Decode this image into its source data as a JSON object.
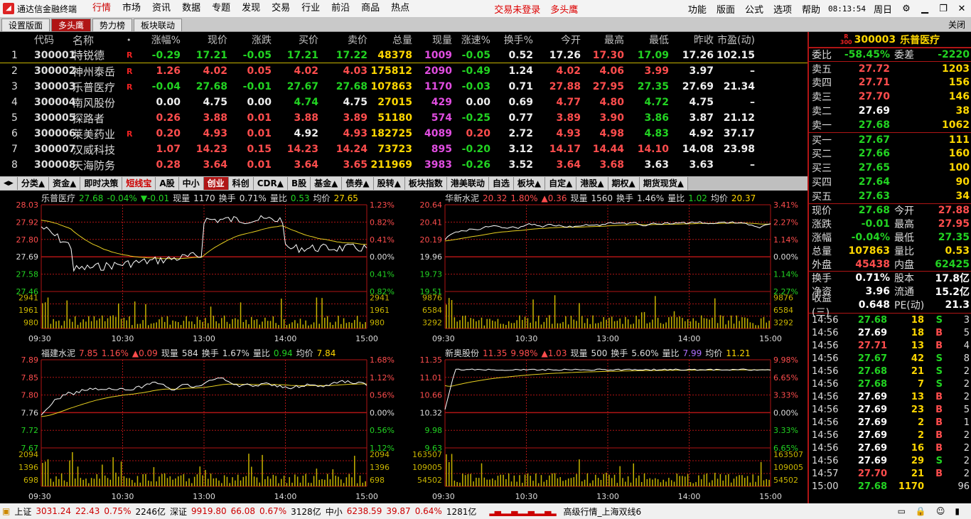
{
  "app": {
    "title": "通达信金融终端",
    "icon": "app-logo-icon"
  },
  "menu": [
    "行情",
    "市场",
    "资讯",
    "数据",
    "专题",
    "发现",
    "交易",
    "行业",
    "前沿",
    "商品",
    "热点"
  ],
  "redlinks": [
    "交易未登录",
    "多头鹰"
  ],
  "rmenu": [
    "功能",
    "版面",
    "公式",
    "选项",
    "帮助"
  ],
  "clock": "08:13:54",
  "weekday": "周日",
  "tabs": [
    "设置版面",
    "多头鹰",
    "势力榜",
    "板块联动"
  ],
  "close_label": "关闭",
  "grid": {
    "headers": [
      "",
      "代码",
      "名称",
      "•",
      "涨幅%",
      "现价",
      "涨跌",
      "买价",
      "卖价",
      "总量",
      "现量",
      "涨速%",
      "换手%",
      "今开",
      "最高",
      "最低",
      "昨收",
      "市盈(动)"
    ],
    "rows": [
      {
        "n": "1",
        "code": "300001",
        "name": "特锐德",
        "flag": "R",
        "chg": "-0.29",
        "price": "17.21",
        "diff": "-0.05",
        "bid": "17.21",
        "ask": "17.22",
        "vol": "48378",
        "cur": "1009",
        "spd": "-0.05",
        "turn": "0.52",
        "open": "17.26",
        "high": "17.30",
        "low": "17.09",
        "prev": "17.26",
        "pe": "102.15"
      },
      {
        "n": "2",
        "code": "300002",
        "name": "神州泰岳",
        "flag": "R",
        "chg": "1.26",
        "price": "4.02",
        "diff": "0.05",
        "bid": "4.02",
        "ask": "4.03",
        "vol": "175812",
        "cur": "2090",
        "spd": "-0.49",
        "turn": "1.24",
        "open": "4.02",
        "high": "4.06",
        "low": "3.99",
        "prev": "3.97",
        "pe": "–"
      },
      {
        "n": "3",
        "code": "300003",
        "name": "乐普医疗",
        "flag": "R",
        "chg": "-0.04",
        "price": "27.68",
        "diff": "-0.01",
        "bid": "27.67",
        "ask": "27.68",
        "vol": "107863",
        "cur": "1170",
        "spd": "-0.03",
        "turn": "0.71",
        "open": "27.88",
        "high": "27.95",
        "low": "27.35",
        "prev": "27.69",
        "pe": "21.34"
      },
      {
        "n": "4",
        "code": "300004",
        "name": "南风股份",
        "flag": "",
        "chg": "0.00",
        "price": "4.75",
        "diff": "0.00",
        "bid": "4.74",
        "ask": "4.75",
        "vol": "27015",
        "cur": "429",
        "spd": "0.00",
        "turn": "0.69",
        "open": "4.77",
        "high": "4.80",
        "low": "4.72",
        "prev": "4.75",
        "pe": "–"
      },
      {
        "n": "5",
        "code": "300005",
        "name": "探路者",
        "flag": "",
        "chg": "0.26",
        "price": "3.88",
        "diff": "0.01",
        "bid": "3.88",
        "ask": "3.89",
        "vol": "51180",
        "cur": "574",
        "spd": "-0.25",
        "turn": "0.77",
        "open": "3.89",
        "high": "3.90",
        "low": "3.86",
        "prev": "3.87",
        "pe": "21.12"
      },
      {
        "n": "6",
        "code": "300006",
        "name": "莱美药业",
        "flag": "R",
        "chg": "0.20",
        "price": "4.93",
        "diff": "0.01",
        "bid": "4.92",
        "ask": "4.93",
        "vol": "182725",
        "cur": "4089",
        "spd": "0.20",
        "turn": "2.72",
        "open": "4.93",
        "high": "4.98",
        "low": "4.83",
        "prev": "4.92",
        "pe": "37.17"
      },
      {
        "n": "7",
        "code": "300007",
        "name": "汉威科技",
        "flag": "",
        "chg": "1.07",
        "price": "14.23",
        "diff": "0.15",
        "bid": "14.23",
        "ask": "14.24",
        "vol": "73723",
        "cur": "895",
        "spd": "-0.20",
        "turn": "3.12",
        "open": "14.17",
        "high": "14.44",
        "low": "14.10",
        "prev": "14.08",
        "pe": "23.98"
      },
      {
        "n": "8",
        "code": "300008",
        "name": "天海防务",
        "flag": "",
        "chg": "0.28",
        "price": "3.64",
        "diff": "0.01",
        "bid": "3.64",
        "ask": "3.65",
        "vol": "211969",
        "cur": "3983",
        "spd": "-0.26",
        "turn": "3.52",
        "open": "3.64",
        "high": "3.68",
        "low": "3.63",
        "prev": "3.63",
        "pe": "–"
      }
    ]
  },
  "sectabs": [
    "分类▲",
    "资金▲",
    "即时决策",
    "短线宝",
    "A股",
    "中小",
    "创业",
    "科创",
    "CDR▲",
    "B股",
    "基金▲",
    "债券▲",
    "股转▲",
    "板块指数",
    "港美联动",
    "自选",
    "板块▲",
    "自定▲",
    "港股▲",
    "期权▲",
    "期货现货▲"
  ],
  "panels": [
    {
      "name": "乐普医疗",
      "price": "27.68",
      "pct": "-0.04%",
      "diff": "▼-0.01",
      "cur_label": "现量",
      "cur": "1170",
      "turn_label": "换手",
      "turn": "0.71%",
      "vr_label": "量比",
      "vr": "0.53",
      "avg_label": "均价",
      "avg": "27.65",
      "up": false,
      "yl": [
        "28.03",
        "27.92",
        "27.80",
        "27.69",
        "27.58",
        "27.46"
      ],
      "yr": [
        "1.23%",
        "0.82%",
        "0.41%",
        "0.00%",
        "0.41%",
        "0.82%"
      ],
      "vl": [
        "2941",
        "1961",
        "980"
      ]
    },
    {
      "name": "华新水泥",
      "price": "20.32",
      "pct": "1.80%",
      "diff": "▲0.36",
      "cur_label": "现量",
      "cur": "1560",
      "turn_label": "换手",
      "turn": "1.46%",
      "vr_label": "量比",
      "vr": "1.02",
      "avg_label": "均价",
      "avg": "20.37",
      "up": true,
      "yl": [
        "20.64",
        "20.41",
        "20.19",
        "19.96",
        "19.73",
        "19.51"
      ],
      "yr": [
        "3.41%",
        "2.27%",
        "1.14%",
        "0.00%",
        "1.14%",
        "2.27%"
      ],
      "vl": [
        "9876",
        "6584",
        "3292"
      ]
    },
    {
      "name": "福建水泥",
      "price": "7.85",
      "pct": "1.16%",
      "diff": "▲0.09",
      "cur_label": "现量",
      "cur": "584",
      "turn_label": "换手",
      "turn": "1.67%",
      "vr_label": "量比",
      "vr": "0.94",
      "avg_label": "均价",
      "avg": "7.84",
      "up": true,
      "yl": [
        "7.89",
        "7.85",
        "7.80",
        "7.76",
        "7.72",
        "7.67"
      ],
      "yr": [
        "1.68%",
        "1.12%",
        "0.56%",
        "0.00%",
        "0.56%",
        "1.12%"
      ],
      "vl": [
        "2094",
        "1396",
        "698"
      ]
    },
    {
      "name": "新奥股份",
      "price": "11.35",
      "pct": "9.98%",
      "diff": "▲1.03",
      "cur_label": "现量",
      "cur": "500",
      "turn_label": "换手",
      "turn": "5.60%",
      "vr_label": "量比",
      "vr": "7.99",
      "avg_label": "均价",
      "avg": "11.21",
      "up": true,
      "yl": [
        "11.35",
        "11.01",
        "10.66",
        "10.32",
        "9.98",
        "9.63"
      ],
      "yr": [
        "9.98%",
        "6.65%",
        "3.33%",
        "0.00%",
        "3.33%",
        "6.65%"
      ],
      "vl": [
        "163507",
        "109005",
        "54502"
      ]
    }
  ],
  "times": [
    "09:30",
    "10:30",
    "13:00",
    "14:00",
    "15:00"
  ],
  "quote": {
    "title_market": "R",
    "title_sub": "300",
    "code": "300003",
    "name": "乐普医疗",
    "wb_label": "委比",
    "wb": "-58.45%",
    "wc_label": "委差",
    "wc": "-2220",
    "asks": [
      {
        "l": "卖五",
        "p": "27.72",
        "q": "1203"
      },
      {
        "l": "卖四",
        "p": "27.71",
        "q": "156"
      },
      {
        "l": "卖三",
        "p": "27.70",
        "q": "146"
      },
      {
        "l": "卖二",
        "p": "27.69",
        "q": "38"
      },
      {
        "l": "卖一",
        "p": "27.68",
        "q": "1062"
      }
    ],
    "bids": [
      {
        "l": "买一",
        "p": "27.67",
        "q": "111"
      },
      {
        "l": "买二",
        "p": "27.66",
        "q": "160"
      },
      {
        "l": "买三",
        "p": "27.65",
        "q": "100"
      },
      {
        "l": "买四",
        "p": "27.64",
        "q": "90"
      },
      {
        "l": "买五",
        "p": "27.63",
        "q": "34"
      }
    ],
    "stats": [
      {
        "l": "现价",
        "v": "27.68",
        "c": "dn",
        "l2": "今开",
        "v2": "27.88",
        "c2": "up"
      },
      {
        "l": "涨跌",
        "v": "-0.01",
        "c": "dn",
        "l2": "最高",
        "v2": "27.95",
        "c2": "up"
      },
      {
        "l": "涨幅",
        "v": "-0.04%",
        "c": "dn",
        "l2": "最低",
        "v2": "27.35",
        "c2": "dn"
      },
      {
        "l": "总量",
        "v": "107863",
        "c": "yel",
        "l2": "量比",
        "v2": "0.53",
        "c2": "yel"
      },
      {
        "l": "外盘",
        "v": "45438",
        "c": "up",
        "l2": "内盘",
        "v2": "62425",
        "c2": "dn"
      }
    ],
    "stats2": [
      {
        "l": "换手",
        "v": "0.71%",
        "c": "wh",
        "l2": "股本",
        "v2": "17.8亿",
        "c2": "wh"
      },
      {
        "l": "净资",
        "v": "3.96",
        "c": "wh",
        "l2": "流通",
        "v2": "15.2亿",
        "c2": "wh"
      },
      {
        "l": "收益(三)",
        "v": "0.648",
        "c": "wh",
        "l2": "PE(动)",
        "v2": "21.3",
        "c2": "wh"
      }
    ],
    "ticks": [
      {
        "t": "14:56",
        "p": "27.68",
        "pc": "dn",
        "v": "18",
        "f": "S",
        "fc": "dn",
        "n": "3"
      },
      {
        "t": "14:56",
        "p": "27.69",
        "pc": "wh",
        "v": "18",
        "f": "B",
        "fc": "up",
        "n": "5"
      },
      {
        "t": "14:56",
        "p": "27.71",
        "pc": "up",
        "v": "13",
        "f": "B",
        "fc": "up",
        "n": "4"
      },
      {
        "t": "14:56",
        "p": "27.67",
        "pc": "dn",
        "v": "42",
        "f": "S",
        "fc": "dn",
        "n": "8"
      },
      {
        "t": "14:56",
        "p": "27.68",
        "pc": "dn",
        "v": "21",
        "f": "S",
        "fc": "dn",
        "n": "2"
      },
      {
        "t": "14:56",
        "p": "27.68",
        "pc": "dn",
        "v": "7",
        "f": "S",
        "fc": "dn",
        "n": "2"
      },
      {
        "t": "14:56",
        "p": "27.69",
        "pc": "wh",
        "v": "13",
        "f": "B",
        "fc": "up",
        "n": "2"
      },
      {
        "t": "14:56",
        "p": "27.69",
        "pc": "wh",
        "v": "23",
        "f": "B",
        "fc": "up",
        "n": "5"
      },
      {
        "t": "14:56",
        "p": "27.69",
        "pc": "wh",
        "v": "2",
        "f": "B",
        "fc": "up",
        "n": "1"
      },
      {
        "t": "14:56",
        "p": "27.69",
        "pc": "wh",
        "v": "2",
        "f": "B",
        "fc": "up",
        "n": "2"
      },
      {
        "t": "14:56",
        "p": "27.69",
        "pc": "wh",
        "v": "16",
        "f": "B",
        "fc": "up",
        "n": "2"
      },
      {
        "t": "14:56",
        "p": "27.69",
        "pc": "wh",
        "v": "29",
        "f": "S",
        "fc": "dn",
        "n": "2"
      },
      {
        "t": "14:57",
        "p": "27.70",
        "pc": "up",
        "v": "21",
        "f": "B",
        "fc": "up",
        "n": "2"
      },
      {
        "t": "15:00",
        "p": "27.68",
        "pc": "dn",
        "v": "1170",
        "f": "",
        "fc": "dn",
        "n": "96"
      }
    ]
  },
  "status": {
    "sh_label": "上证",
    "sh": "3031.24",
    "sh_d": "22.43",
    "sh_p": "0.75%",
    "sh_amt": "2246亿",
    "sz_label": "深证",
    "sz": "9919.80",
    "sz_d": "66.08",
    "sz_p": "0.67%",
    "sz_amt": "3128亿",
    "zx_label": "中小",
    "zx": "6238.59",
    "zx_d": "39.87",
    "zx_p": "0.64%",
    "zx_amt": "1281亿",
    "feed": "高级行情_上海双线6"
  },
  "colors": {
    "up": "#ff4d4d",
    "down": "#22d322",
    "accent": "#b01515",
    "volume": "#c8b400"
  }
}
